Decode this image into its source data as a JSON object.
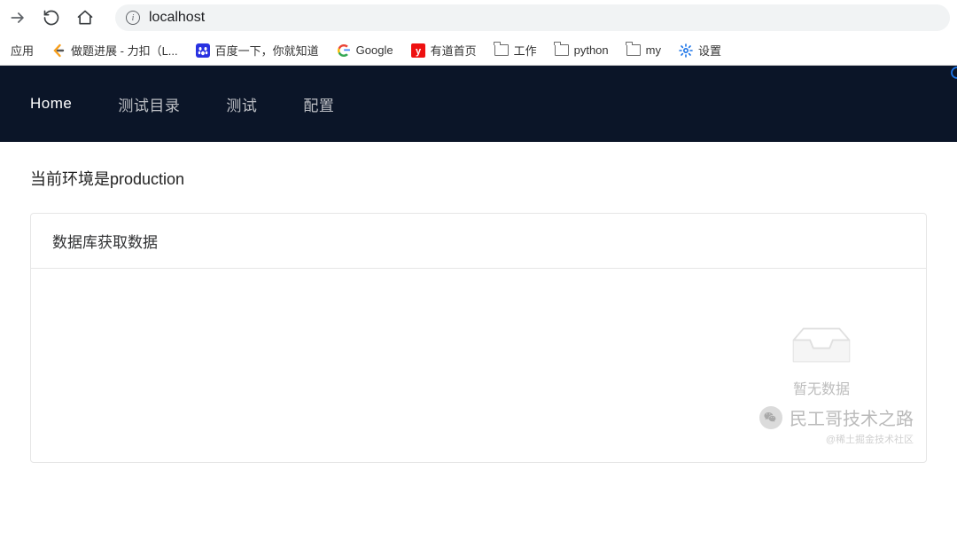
{
  "browser": {
    "url": "localhost",
    "bookmarks": [
      {
        "label": "应用",
        "icon": "apps"
      },
      {
        "label": "做题进展 - 力扣（L...",
        "icon": "leetcode"
      },
      {
        "label": "百度一下，你就知道",
        "icon": "baidu"
      },
      {
        "label": "Google",
        "icon": "google"
      },
      {
        "label": "有道首页",
        "icon": "youdao"
      },
      {
        "label": "工作",
        "icon": "folder"
      },
      {
        "label": "python",
        "icon": "folder"
      },
      {
        "label": "my",
        "icon": "folder"
      },
      {
        "label": "设置",
        "icon": "settings"
      }
    ]
  },
  "nav": {
    "items": [
      "Home",
      "测试目录",
      "测试",
      "配置"
    ],
    "activeIndex": 0
  },
  "page": {
    "env_text": "当前环境是production",
    "card_title": "数据库获取数据",
    "empty_text": "暂无数据"
  },
  "watermark": {
    "title": "民工哥技术之路",
    "sub": "@稀土掘金技术社区"
  }
}
